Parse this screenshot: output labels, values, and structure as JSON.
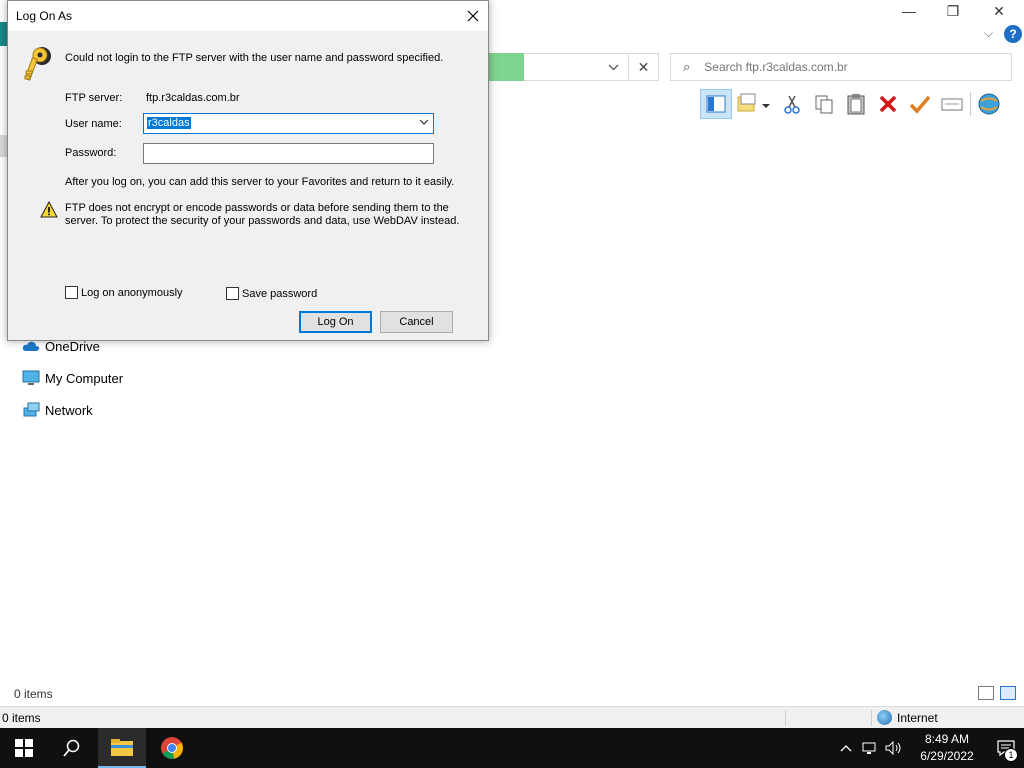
{
  "explorer": {
    "search_placeholder": "Search ftp.r3caldas.com.br",
    "nav": {
      "onedrive": "OneDrive",
      "my_computer": "My Computer",
      "network": "Network"
    },
    "items_count": "0 items",
    "status": {
      "items": "0 items",
      "zone": "Internet"
    },
    "caption": {
      "minimize": "—",
      "restore": "❐",
      "close": "✕"
    },
    "help_label": "?"
  },
  "dialog": {
    "title": "Log On As",
    "message": "Could not login to the FTP server with the user name and password specified.",
    "server_label": "FTP server:",
    "server_value": "ftp.r3caldas.com.br",
    "username_label": "User name:",
    "username_value": "r3caldas",
    "password_label": "Password:",
    "password_value": "",
    "after_logon_text": "After you log on, you can add this server to your Favorites and return to it easily.",
    "warning_text": "FTP does not encrypt or encode passwords or data before sending them to the server.  To protect the security of your passwords and data, use WebDAV instead.",
    "anonymous_label": "Log on anonymously",
    "save_password_label": "Save password",
    "anonymous_checked": false,
    "save_password_checked": false,
    "logon_button": "Log On",
    "cancel_button": "Cancel"
  },
  "taskbar": {
    "time": "8:49 AM",
    "date": "6/29/2022",
    "notification_count": "1",
    "apps": [
      "start-icon",
      "search-icon",
      "file-explorer-icon",
      "chrome-icon"
    ]
  },
  "colors": {
    "accent": "#0078d7",
    "taskbar": "#101010",
    "progress_green": "#7ed58f"
  }
}
